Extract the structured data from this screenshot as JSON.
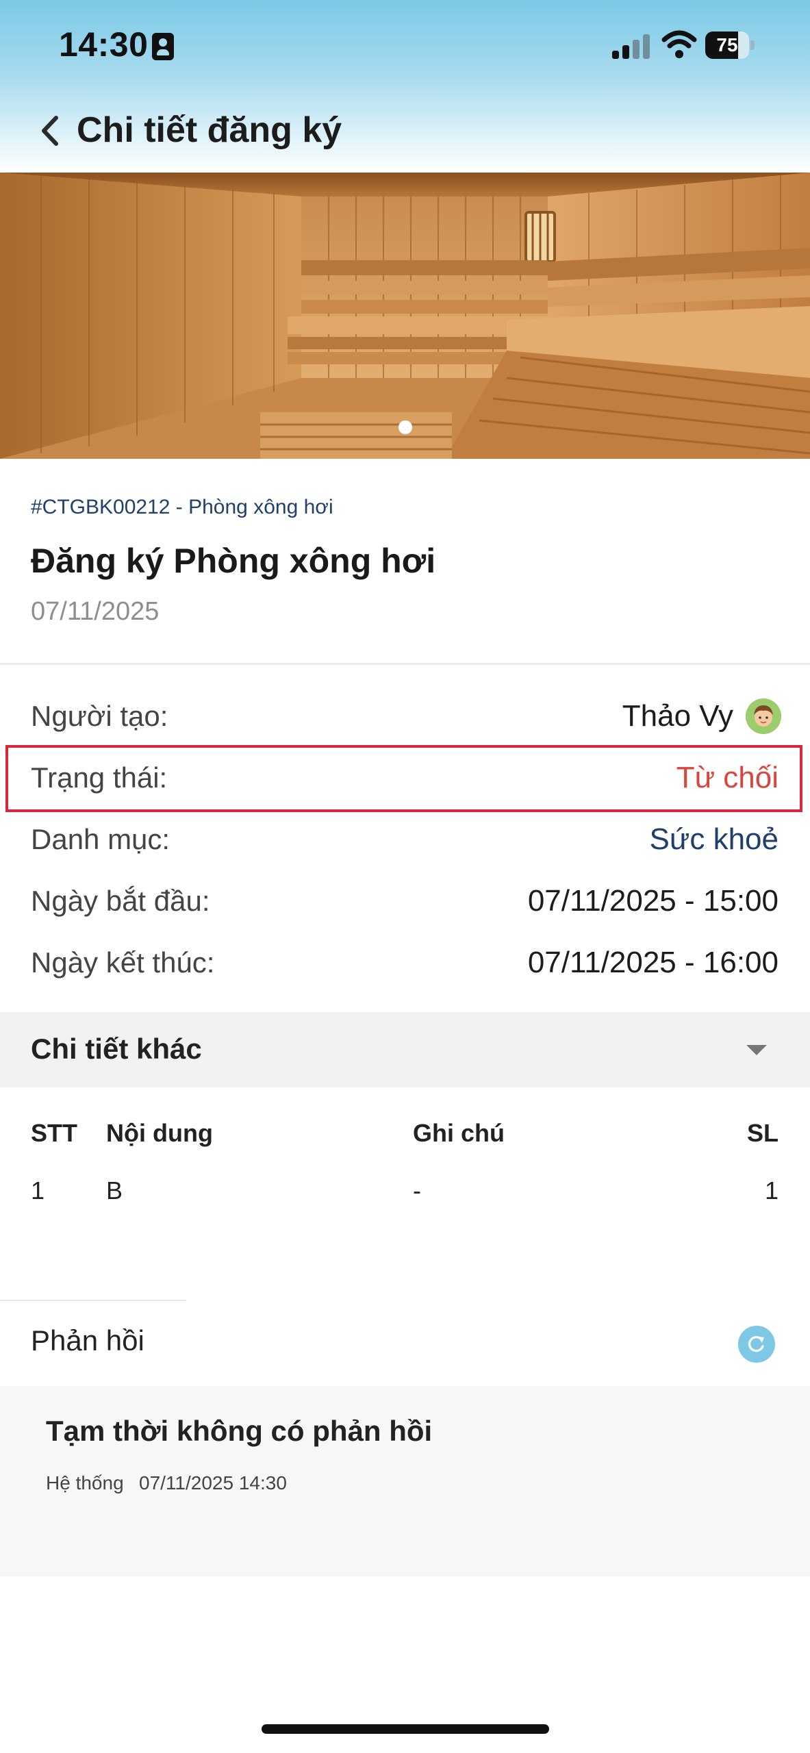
{
  "status_bar": {
    "time": "14:30",
    "battery_percent": "75",
    "battery_level": 0.75,
    "signal_bars_active": 2,
    "signal_bars_total": 4
  },
  "header": {
    "back_icon": "chevron-left-icon",
    "title": "Chi tiết đăng ký"
  },
  "banner": {
    "slide_count": 1,
    "active_slide": 1
  },
  "registration": {
    "code": "#CTGBK00212 - Phòng xông hơi",
    "title": "Đăng ký Phòng xông hơi",
    "date": "07/11/2025"
  },
  "details": {
    "creator_label": "Người tạo:",
    "creator_value": "Thảo Vy",
    "status_label": "Trạng thái:",
    "status_value": "Từ chối",
    "category_label": "Danh mục:",
    "category_value": "Sức khoẻ",
    "start_label": "Ngày bắt đầu:",
    "start_value": "07/11/2025 - 15:00",
    "end_label": "Ngày kết thúc:",
    "end_value": "07/11/2025 - 16:00"
  },
  "other_details": {
    "title": "Chi tiết khác",
    "columns": [
      "STT",
      "Nội dung",
      "Ghi chú",
      "SL"
    ],
    "rows": [
      [
        "1",
        "B",
        "-",
        "1"
      ]
    ]
  },
  "feedback": {
    "title": "Phản hồi",
    "empty_message": "Tạm thời không có phản hồi",
    "author": "Hệ thống",
    "timestamp": "07/11/2025 14:30"
  },
  "colors": {
    "status_rejected": "#d9453f",
    "category": "#1f3f6d",
    "code": "#22406c",
    "highlight_border": "#d9263a",
    "refresh_button": "#7ec8e6"
  }
}
